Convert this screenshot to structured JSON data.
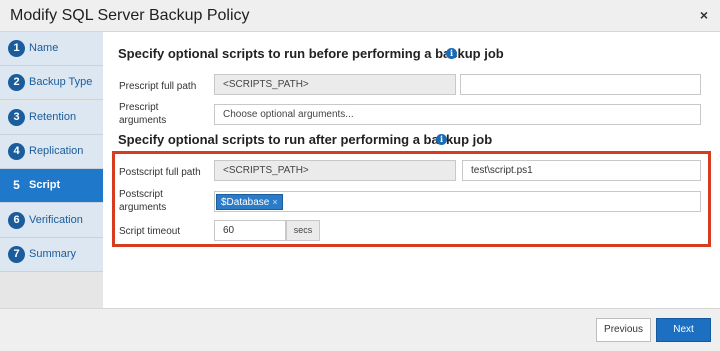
{
  "window": {
    "title": "Modify SQL Server Backup Policy"
  },
  "steps": [
    {
      "num": "1",
      "label": "Name"
    },
    {
      "num": "2",
      "label": "Backup Type"
    },
    {
      "num": "3",
      "label": "Retention"
    },
    {
      "num": "4",
      "label": "Replication"
    },
    {
      "num": "5",
      "label": "Script",
      "active": true
    },
    {
      "num": "6",
      "label": "Verification"
    },
    {
      "num": "7",
      "label": "Summary"
    }
  ],
  "prescript": {
    "heading": "Specify optional scripts to run before performing a backup job",
    "path_label": "Prescript full path",
    "path_prefix": "<SCRIPTS_PATH>",
    "path_value": "",
    "args_label": "Prescript arguments",
    "args_placeholder": "Choose optional arguments..."
  },
  "postscript": {
    "heading": "Specify optional scripts to run after performing a backup job",
    "path_label": "Postscript full path",
    "path_prefix": "<SCRIPTS_PATH>",
    "path_value": "test\\script.ps1",
    "args_label": "Postscript arguments",
    "arg_tag": "$Database",
    "arg_tag_remove": "×",
    "timeout_label": "Script timeout",
    "timeout_value": "60",
    "timeout_unit": "secs"
  },
  "info_glyph": "i",
  "close_glyph": "×",
  "buttons": {
    "previous": "Previous",
    "next": "Next"
  },
  "colors": {
    "accent": "#1f78c9",
    "highlight": "#d63c1f"
  }
}
